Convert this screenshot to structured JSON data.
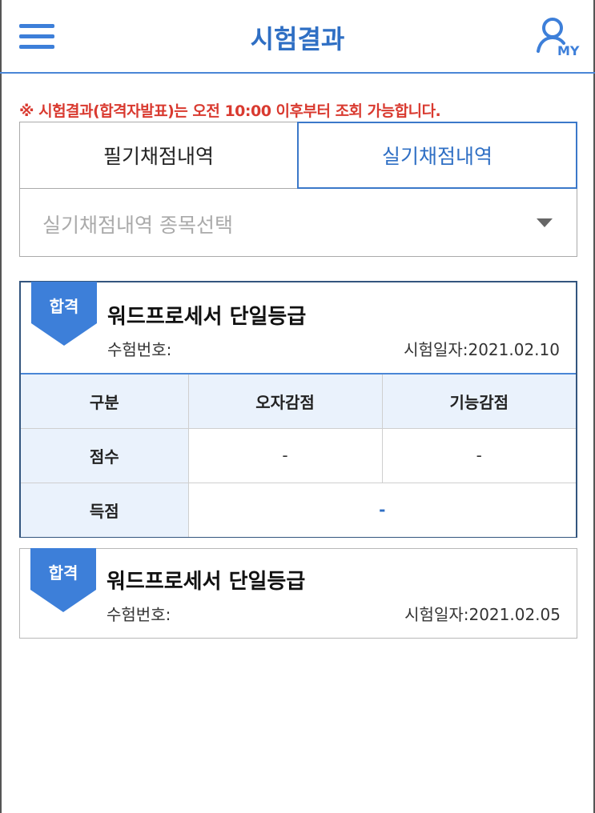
{
  "header": {
    "title": "시험결과",
    "menu_icon": "hamburger-menu-icon",
    "my_icon": "user-my-icon",
    "my_label": "MY",
    "accent_color": "#3d7fd9"
  },
  "notice": {
    "text": "※ 시험결과(합격자발표)는 오전 10:00 이후부터 조회 가능합니다.",
    "color": "#d93a30"
  },
  "tabs": [
    {
      "label": "필기채점내역",
      "active": false
    },
    {
      "label": "실기채점내역",
      "active": true
    }
  ],
  "select": {
    "placeholder": "실기채점내역 종목선택"
  },
  "results": [
    {
      "badge": "합격",
      "name": "워드프로세서 단일등급",
      "exam_number_label": "수험번호:",
      "exam_date_label": "시험일자:2021.02.10",
      "expanded": true,
      "table": {
        "headers": [
          "구분",
          "오자감점",
          "기능감점"
        ],
        "rows": [
          {
            "label": "점수",
            "values": [
              "-",
              "-"
            ]
          },
          {
            "label": "득점",
            "values": [
              "-"
            ]
          }
        ]
      }
    },
    {
      "badge": "합격",
      "name": "워드프로세서 단일등급",
      "exam_number_label": "수험번호:",
      "exam_date_label": "시험일자:2021.02.05",
      "expanded": false
    }
  ],
  "badge_color": "#3d7fd9"
}
